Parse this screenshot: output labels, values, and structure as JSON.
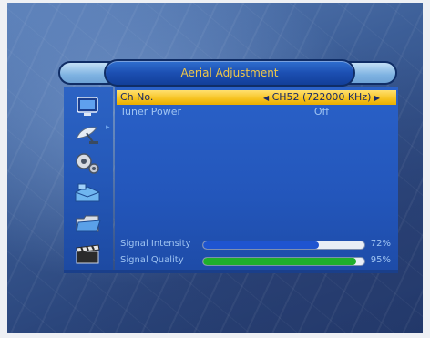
{
  "title": "Aerial Adjustment",
  "rows": [
    {
      "label": "Ch No.",
      "value": "CH52 (722000 KHz)",
      "selected": true
    },
    {
      "label": "Tuner Power",
      "value": "Off",
      "selected": false
    }
  ],
  "signals": [
    {
      "label": "Signal Intensity",
      "text": "72%",
      "value": 0.72,
      "color": "#1e54d0"
    },
    {
      "label": "Signal Quality",
      "text": "95%",
      "value": 0.95,
      "color": "#1fae2c"
    }
  ],
  "icons": [
    "monitor-icon",
    "satellite-dish-icon",
    "gears-icon",
    "toolbox-icon",
    "folder-icon",
    "clapperboard-icon"
  ],
  "colors": {
    "highlight": "#f6c21f",
    "title_text": "#f0c84a",
    "panel": "#2356bb"
  }
}
